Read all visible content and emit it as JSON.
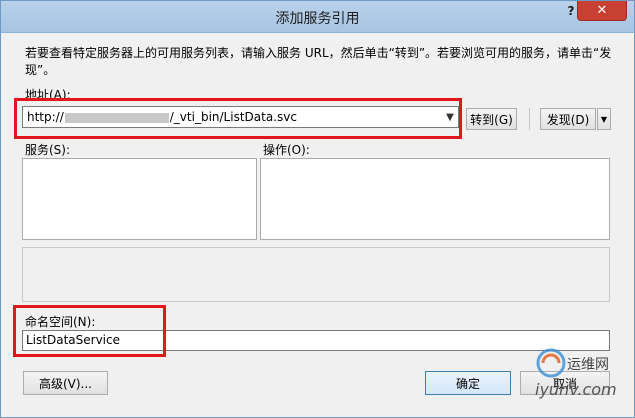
{
  "window": {
    "title": "添加服务引用",
    "help_glyph": "?",
    "close_glyph": "✕"
  },
  "description": "若要查看特定服务器上的可用服务列表，请输入服务 URL，然后单击“转到”。若要浏览可用的服务，请单击“发现”。",
  "address": {
    "label": "地址(A):",
    "value_prefix": "http://",
    "value_suffix": "/_vti_bin/ListData.svc",
    "go_button": "转到(G)",
    "discover_button": "发现(D)"
  },
  "services": {
    "label": "服务(S):"
  },
  "operations": {
    "label": "操作(O):"
  },
  "namespace": {
    "label": "命名空间(N):",
    "value": "ListDataService"
  },
  "buttons": {
    "advanced": "高级(V)...",
    "ok": "确定",
    "cancel": "取消"
  },
  "watermark": {
    "brand": "运维网",
    "url": "iyunv.com"
  },
  "colors": {
    "highlight": "#e3161d",
    "titlebar": "#a7c4e2",
    "close_button": "#c84031"
  }
}
